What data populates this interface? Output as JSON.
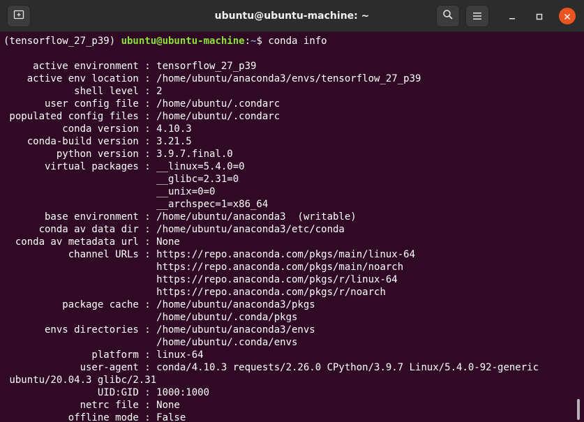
{
  "window": {
    "title": "ubuntu@ubuntu-machine: ~"
  },
  "icons": {
    "new_tab": "new-tab-icon",
    "search": "search-icon",
    "menu": "hamburger-menu-icon",
    "minimize": "minimize-icon",
    "maximize": "maximize-icon",
    "close": "close-icon"
  },
  "colors": {
    "terminal_background": "#300a24",
    "titlebar_background": "#2c2c2c",
    "prompt_user": "#8ae234",
    "prompt_path": "#729fcf",
    "close_button": "#e95420",
    "text": "#ffffff"
  },
  "terminal": {
    "prompt": {
      "env": "(tensorflow_27_p39) ",
      "user_host": "ubuntu@ubuntu-machine",
      "separator": ":",
      "path": "~",
      "symbol": "$ ",
      "command": "conda info"
    },
    "output_lines": [
      "",
      "     active environment : tensorflow_27_p39",
      "    active env location : /home/ubuntu/anaconda3/envs/tensorflow_27_p39",
      "            shell level : 2",
      "       user config file : /home/ubuntu/.condarc",
      " populated config files : /home/ubuntu/.condarc",
      "          conda version : 4.10.3",
      "    conda-build version : 3.21.5",
      "         python version : 3.9.7.final.0",
      "       virtual packages : __linux=5.4.0=0",
      "                          __glibc=2.31=0",
      "                          __unix=0=0",
      "                          __archspec=1=x86_64",
      "       base environment : /home/ubuntu/anaconda3  (writable)",
      "      conda av data dir : /home/ubuntu/anaconda3/etc/conda",
      "  conda av metadata url : None",
      "           channel URLs : https://repo.anaconda.com/pkgs/main/linux-64",
      "                          https://repo.anaconda.com/pkgs/main/noarch",
      "                          https://repo.anaconda.com/pkgs/r/linux-64",
      "                          https://repo.anaconda.com/pkgs/r/noarch",
      "          package cache : /home/ubuntu/anaconda3/pkgs",
      "                          /home/ubuntu/.conda/pkgs",
      "       envs directories : /home/ubuntu/anaconda3/envs",
      "                          /home/ubuntu/.conda/envs",
      "               platform : linux-64",
      "             user-agent : conda/4.10.3 requests/2.26.0 CPython/3.9.7 Linux/5.4.0-92-generic",
      " ubuntu/20.04.3 glibc/2.31",
      "                UID:GID : 1000:1000",
      "             netrc file : None",
      "           offline mode : False"
    ]
  }
}
